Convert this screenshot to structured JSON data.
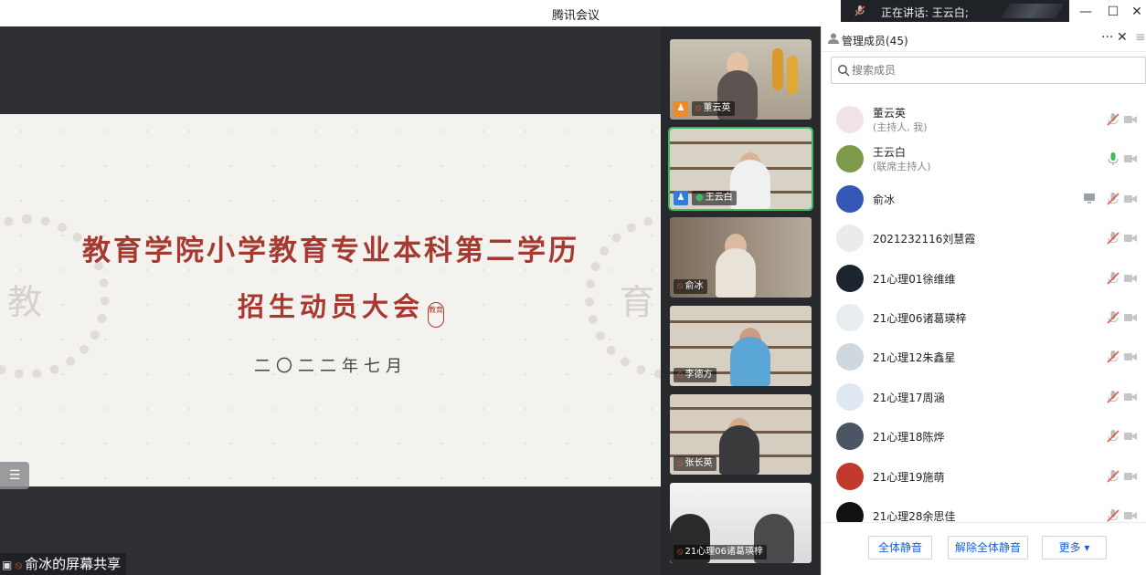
{
  "window": {
    "title": "腾讯会议",
    "speaking_text": "正在讲话: 王云白;",
    "minimize": "—",
    "maximize": "☐",
    "close": "✕"
  },
  "slide": {
    "title": "教育学院小学教育专业本科第二学历",
    "subtitle": "招生动员大会",
    "seal_text": "教育",
    "date": "二〇二二年七月",
    "side_char_left": "教",
    "side_char_right": "育"
  },
  "share_label": "俞冰的屏幕共享",
  "video_tiles": [
    {
      "name": "董云英",
      "mic": "muted",
      "badge": "host"
    },
    {
      "name": "王云白",
      "mic": "on",
      "badge": "cohost",
      "active": true
    },
    {
      "name": "俞冰",
      "mic": "muted"
    },
    {
      "name": "李德方",
      "mic": "muted"
    },
    {
      "name": "张长英",
      "mic": "muted"
    },
    {
      "name": "21心理06诸葛瑛梓",
      "mic": "muted"
    }
  ],
  "panel": {
    "title": "管理成员(45)",
    "more": "···",
    "close": "✕",
    "menu": "≡",
    "search_placeholder": "搜索成员",
    "members": [
      {
        "name": "董云英",
        "role": "(主持人, 我)",
        "mic": "muted"
      },
      {
        "name": "王云白",
        "role": "(联席主持人)",
        "mic": "on"
      },
      {
        "name": "俞冰",
        "role": "",
        "mic": "muted",
        "sharing": true
      },
      {
        "name": "2021232116刘慧霞",
        "role": "",
        "mic": "muted"
      },
      {
        "name": "21心理01徐维维",
        "role": "",
        "mic": "muted"
      },
      {
        "name": "21心理06诸葛瑛梓",
        "role": "",
        "mic": "muted"
      },
      {
        "name": "21心理12朱鑫星",
        "role": "",
        "mic": "muted"
      },
      {
        "name": "21心理17周涵",
        "role": "",
        "mic": "muted"
      },
      {
        "name": "21心理18陈烨",
        "role": "",
        "mic": "muted"
      },
      {
        "name": "21心理19施萌",
        "role": "",
        "mic": "muted"
      },
      {
        "name": "21心理28余思佳",
        "role": "",
        "mic": "muted"
      }
    ],
    "buttons": {
      "mute_all": "全体静音",
      "unmute_all": "解除全体静音",
      "more": "更多 ▾"
    }
  },
  "colors": {
    "accent": "#1a5fd6",
    "muted_mic": "#e45b45",
    "active_mic": "#3dbb5d",
    "slide_red": "#a73a30"
  }
}
